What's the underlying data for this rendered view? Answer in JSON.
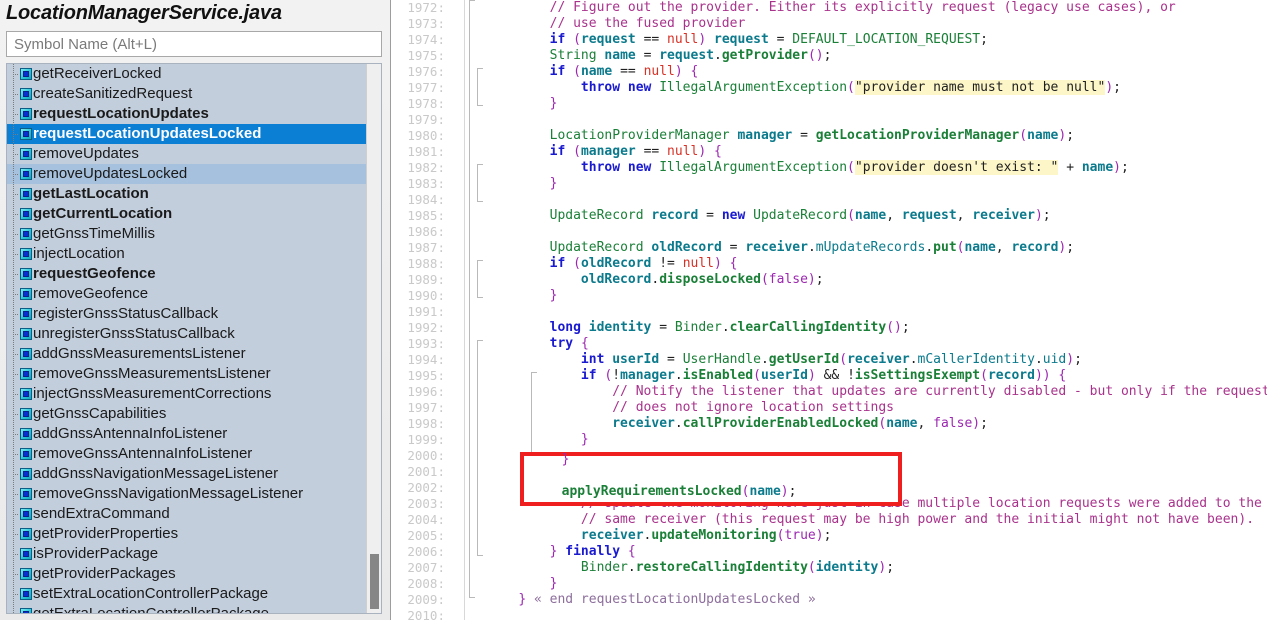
{
  "panel": {
    "title": "LocationManagerService.java",
    "search_placeholder": "Symbol Name (Alt+L)",
    "search_value": "",
    "items": [
      {
        "label": "getReceiverLocked",
        "bold": false,
        "state": "none"
      },
      {
        "label": "createSanitizedRequest",
        "bold": false,
        "state": "none"
      },
      {
        "label": "requestLocationUpdates",
        "bold": true,
        "state": "none"
      },
      {
        "label": "requestLocationUpdatesLocked",
        "bold": true,
        "state": "selected"
      },
      {
        "label": "removeUpdates",
        "bold": false,
        "state": "none"
      },
      {
        "label": "removeUpdatesLocked",
        "bold": false,
        "state": "highlighted"
      },
      {
        "label": "getLastLocation",
        "bold": true,
        "state": "none"
      },
      {
        "label": "getCurrentLocation",
        "bold": true,
        "state": "none"
      },
      {
        "label": "getGnssTimeMillis",
        "bold": false,
        "state": "none"
      },
      {
        "label": "injectLocation",
        "bold": false,
        "state": "none"
      },
      {
        "label": "requestGeofence",
        "bold": true,
        "state": "none"
      },
      {
        "label": "removeGeofence",
        "bold": false,
        "state": "none"
      },
      {
        "label": "registerGnssStatusCallback",
        "bold": false,
        "state": "none"
      },
      {
        "label": "unregisterGnssStatusCallback",
        "bold": false,
        "state": "none"
      },
      {
        "label": "addGnssMeasurementsListener",
        "bold": false,
        "state": "none"
      },
      {
        "label": "removeGnssMeasurementsListener",
        "bold": false,
        "state": "none"
      },
      {
        "label": "injectGnssMeasurementCorrections",
        "bold": false,
        "state": "none"
      },
      {
        "label": "getGnssCapabilities",
        "bold": false,
        "state": "none"
      },
      {
        "label": "addGnssAntennaInfoListener",
        "bold": false,
        "state": "none"
      },
      {
        "label": "removeGnssAntennaInfoListener",
        "bold": false,
        "state": "none"
      },
      {
        "label": "addGnssNavigationMessageListener",
        "bold": false,
        "state": "none"
      },
      {
        "label": "removeGnssNavigationMessageListener",
        "bold": false,
        "state": "none"
      },
      {
        "label": "sendExtraCommand",
        "bold": false,
        "state": "none"
      },
      {
        "label": "getProviderProperties",
        "bold": false,
        "state": "none"
      },
      {
        "label": "isProviderPackage",
        "bold": false,
        "state": "none"
      },
      {
        "label": "getProviderPackages",
        "bold": false,
        "state": "none"
      },
      {
        "label": "setExtraLocationControllerPackage",
        "bold": false,
        "state": "none"
      },
      {
        "label": "getExtraLocationControllerPackage",
        "bold": false,
        "state": "none"
      }
    ]
  },
  "editor": {
    "first_line": 1972,
    "last_line": 2010,
    "line_numbers": [
      "1972:",
      "1973:",
      "1974:",
      "1975:",
      "1976:",
      "1977:",
      "1978:",
      "1979:",
      "1980:",
      "1981:",
      "1982:",
      "1983:",
      "1984:",
      "1985:",
      "1986:",
      "1987:",
      "1988:",
      "1989:",
      "1990:",
      "1991:",
      "1992:",
      "1993:",
      "1994:",
      "1995:",
      "1996:",
      "1997:",
      "1998:",
      "1999:",
      "2000:",
      "2001:",
      "2002:",
      "2003:",
      "2004:",
      "2005:",
      "2006:",
      "2007:",
      "2008:",
      "2009:",
      "2010:"
    ],
    "lines": [
      "        // Figure out the provider. Either its explicitly request (legacy use cases), or",
      "        // use the fused provider",
      "        if (request == null) request = DEFAULT_LOCATION_REQUEST;",
      "        String name = request.getProvider();",
      "        if (name == null) {",
      "            throw new IllegalArgumentException(\"provider name must not be null\");",
      "        }",
      "",
      "        LocationProviderManager manager = getLocationProviderManager(name);",
      "        if (manager == null) {",
      "            throw new IllegalArgumentException(\"provider doesn't exist: \" + name);",
      "        }",
      "",
      "        UpdateRecord record = new UpdateRecord(name, request, receiver);",
      "",
      "        UpdateRecord oldRecord = receiver.mUpdateRecords.put(name, record);",
      "        if (oldRecord != null) {",
      "            oldRecord.disposeLocked(false);",
      "        }",
      "",
      "        long identity = Binder.clearCallingIdentity();",
      "        try {",
      "            int userId = UserHandle.getUserId(receiver.mCallerIdentity.uid);",
      "            if (!manager.isEnabled(userId) && !isSettingsExempt(record)) {",
      "                // Notify the listener that updates are currently disabled - but only if the request",
      "                // does not ignore location settings",
      "                receiver.callProviderEnabledLocked(name, false);",
      "            }",
      "",
      "            applyRequirementsLocked(name);",
      "",
      "            // Update the monitoring here just in case multiple location requests were added to the",
      "            // same receiver (this request may be high power and the initial might not have been).",
      "            receiver.updateMonitoring(true);",
      "        } finally {",
      "            Binder.restoreCallingIdentity(identity);",
      "        }",
      "    } « end requestLocationUpdatesLocked »",
      ""
    ],
    "fold_end_label": "« end requestLocationUpdatesLocked »",
    "annotation": {
      "shape": "rectangle",
      "color": "#ef1f1f",
      "highlighted_code": "        }\n\n        applyRequirementsLocked(name);"
    }
  },
  "colors": {
    "comment": "#a9328c",
    "keyword": "#1a1ad0",
    "type": "#1a7f37",
    "method": "#1a7f37",
    "variable": "#0b7a8c",
    "null_literal": "#d93025",
    "string_bg": "#fcf6c8",
    "selection_bg": "#0b7fd4",
    "tree_bg": "#c3cedd",
    "annotation": "#ef1f1f"
  }
}
